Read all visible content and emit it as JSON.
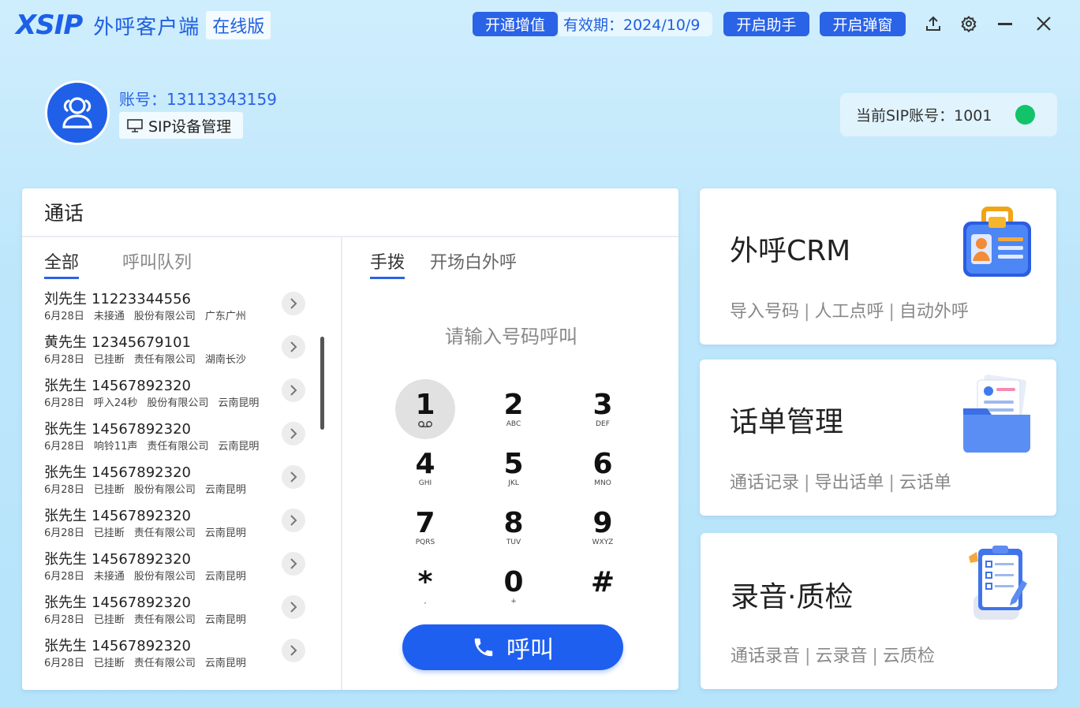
{
  "app": {
    "logo": "XSIP",
    "title": "外呼客户端",
    "edition": "在线版"
  },
  "topbar": {
    "open_value_label": "开通增值",
    "validity": "有效期：2024/10/9",
    "open_assistant_label": "开启助手",
    "open_popup_label": "开启弹窗"
  },
  "account": {
    "label": "账号：13113343159",
    "sip_device_label": "SIP设备管理",
    "current_sip": "当前SIP账号：1001",
    "status_color": "#12c36a"
  },
  "call_panel": {
    "title": "通话",
    "list_tabs": [
      "全部",
      "呼叫队列"
    ],
    "dial_tabs": [
      "手拨",
      "开场白外呼"
    ],
    "placeholder": "请输入号码呼叫",
    "call_button": "呼叫",
    "records": [
      {
        "name": "刘先生",
        "number": "11223344556",
        "date": "6月28日",
        "status": "未接通",
        "company": "股份有限公司",
        "region": "广东广州"
      },
      {
        "name": "黄先生",
        "number": "12345679101",
        "date": "6月28日",
        "status": "已挂断",
        "company": "责任有限公司",
        "region": "湖南长沙"
      },
      {
        "name": "张先生",
        "number": "14567892320",
        "date": "6月28日",
        "status": "呼入24秒",
        "company": "股份有限公司",
        "region": "云南昆明"
      },
      {
        "name": "张先生",
        "number": "14567892320",
        "date": "6月28日",
        "status": "响铃11声",
        "company": "责任有限公司",
        "region": "云南昆明"
      },
      {
        "name": "张先生",
        "number": "14567892320",
        "date": "6月28日",
        "status": "已挂断",
        "company": "股份有限公司",
        "region": "云南昆明"
      },
      {
        "name": "张先生",
        "number": "14567892320",
        "date": "6月28日",
        "status": "已挂断",
        "company": "责任有限公司",
        "region": "云南昆明"
      },
      {
        "name": "张先生",
        "number": "14567892320",
        "date": "6月28日",
        "status": "未接通",
        "company": "股份有限公司",
        "region": "云南昆明"
      },
      {
        "name": "张先生",
        "number": "14567892320",
        "date": "6月28日",
        "status": "已挂断",
        "company": "责任有限公司",
        "region": "云南昆明"
      },
      {
        "name": "张先生",
        "number": "14567892320",
        "date": "6月28日",
        "status": "已挂断",
        "company": "责任有限公司",
        "region": "云南昆明"
      }
    ],
    "keys": [
      {
        "digit": "1",
        "sub": "voicemail-icon"
      },
      {
        "digit": "2",
        "sub": "ABC"
      },
      {
        "digit": "3",
        "sub": "DEF"
      },
      {
        "digit": "4",
        "sub": "GHI"
      },
      {
        "digit": "5",
        "sub": "JKL"
      },
      {
        "digit": "6",
        "sub": "MNO"
      },
      {
        "digit": "7",
        "sub": "PQRS"
      },
      {
        "digit": "8",
        "sub": "TUV"
      },
      {
        "digit": "9",
        "sub": "WXYZ"
      },
      {
        "digit": "*",
        "sub": ","
      },
      {
        "digit": "0",
        "sub": "+"
      },
      {
        "digit": "#",
        "sub": ""
      }
    ]
  },
  "cards": [
    {
      "title": "外呼CRM",
      "links": [
        "导入号码",
        "人工点呼",
        "自动外呼"
      ],
      "icon": "id-card-icon"
    },
    {
      "title": "话单管理",
      "links": [
        "通话记录",
        "导出话单",
        "云话单"
      ],
      "icon": "folder-icon"
    },
    {
      "title": "录音·质检",
      "links": [
        "通话录音",
        "云录音",
        "云质检"
      ],
      "icon": "clipboard-icon"
    }
  ],
  "colors": {
    "accent": "#2a63e6",
    "call_button": "#1e5ff0"
  }
}
